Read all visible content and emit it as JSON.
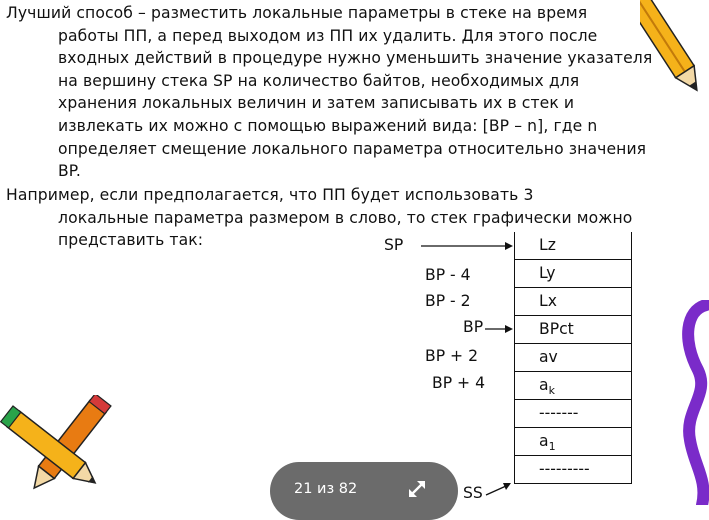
{
  "paragraphs": {
    "p1": {
      "first": "Лучший способ – разместить локальные параметры в стеке на время",
      "lines": [
        "работы ПП, а перед выходом из ПП их удалить. Для этого после",
        "входных действий в процедуре нужно уменьшить значение указателя",
        "на вершину стека SP на количество байтов, необходимых для",
        "хранения локальных величин и затем записывать их в стек и",
        "извлекать их  можно с помощью выражений вида: [BP – n], где n",
        "определяет смещение локального параметра относительно значения",
        "BP."
      ]
    },
    "p2": {
      "first": "Например, если предполагается, что ПП будет использовать 3",
      "lines": [
        "локальные параметра размером в слово, то стек графически можно",
        "представить так:"
      ]
    }
  },
  "stack": {
    "labels": {
      "sp": "SP",
      "bp_minus_4": "BP  - 4",
      "bp_minus_2": "BP  - 2",
      "bp": "BP",
      "bp_plus_2": "BP + 2",
      "bp_plus_4": "BP + 4",
      "ss": "SS"
    },
    "cells": [
      "Lz",
      "Ly",
      "Lx",
      "BPct",
      "av",
      "ak",
      "-------",
      "a1",
      "---------"
    ]
  },
  "viewer": {
    "page_counter": "21 из 82",
    "expand_icon": "expand-arrows-icon"
  },
  "colors": {
    "pill_bg": "#6b6b6b",
    "pencil_yellow": "#f5b21a",
    "pencil_orange": "#e87b12",
    "clip_purple": "#7a2bc9"
  }
}
